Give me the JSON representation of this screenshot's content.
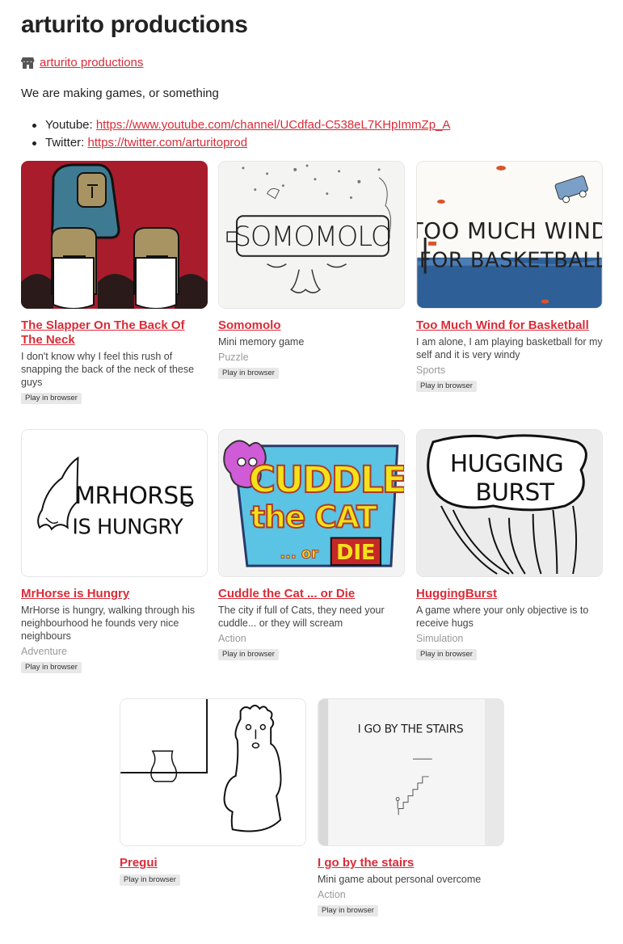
{
  "header": {
    "title": "arturito productions",
    "byline_link": "arturito productions",
    "description": "We are making games, or something"
  },
  "links": [
    {
      "label": "Youtube: ",
      "url": "https://www.youtube.com/channel/UCdfad-C538eL7KHpImmZp_A"
    },
    {
      "label": "Twitter: ",
      "url": "https://twitter.com/arturitoprod"
    }
  ],
  "games": [
    {
      "title": "The Slapper On The Back Of The Neck",
      "description": "I don't know why I feel this rush of snapping the back of the neck of these guys",
      "genre": "",
      "badge": "Play in browser"
    },
    {
      "title": "Somomolo",
      "description": "Mini memory game",
      "genre": "Puzzle",
      "badge": "Play in browser",
      "cover_text": "SOMOMOLO"
    },
    {
      "title": "Too Much Wind for Basketball",
      "description": "I am alone, I am playing basketball for my self and it is very windy",
      "genre": "Sports",
      "badge": "Play in browser",
      "cover_text_1": "TOO MUCH WIND",
      "cover_text_2": "FOR BASKETBALL"
    },
    {
      "title": "MrHorse is Hungry",
      "description": "MrHorse is hungry, walking through his neighbourhood he founds very nice neighbours",
      "genre": "Adventure",
      "badge": "Play in browser",
      "cover_text_1": "MRHORSE",
      "cover_text_2": "IS HUNGRY"
    },
    {
      "title": "Cuddle the Cat ... or Die",
      "description": "The city if full of Cats, they need your cuddle... or they will scream",
      "genre": "Action",
      "badge": "Play in browser",
      "cover_text_1": "CUDDLE",
      "cover_text_2": "the CAT",
      "cover_text_3": "... or",
      "cover_text_4": "DIE"
    },
    {
      "title": "HuggingBurst",
      "description": "A game where your only objective is to receive hugs",
      "genre": "Simulation",
      "badge": "Play in browser",
      "cover_text_1": "HUGGING",
      "cover_text_2": "BURST"
    },
    {
      "title": "Pregui",
      "description": "",
      "genre": "",
      "badge": "Play in browser"
    },
    {
      "title": "I go by the stairs",
      "description": "Mini game about personal overcome",
      "genre": "Action",
      "badge": "Play in browser",
      "cover_text": "I GO BY THE STAIRS"
    }
  ],
  "colors": {
    "link": "#da2c38",
    "badge_bg": "#e8e8e8"
  }
}
